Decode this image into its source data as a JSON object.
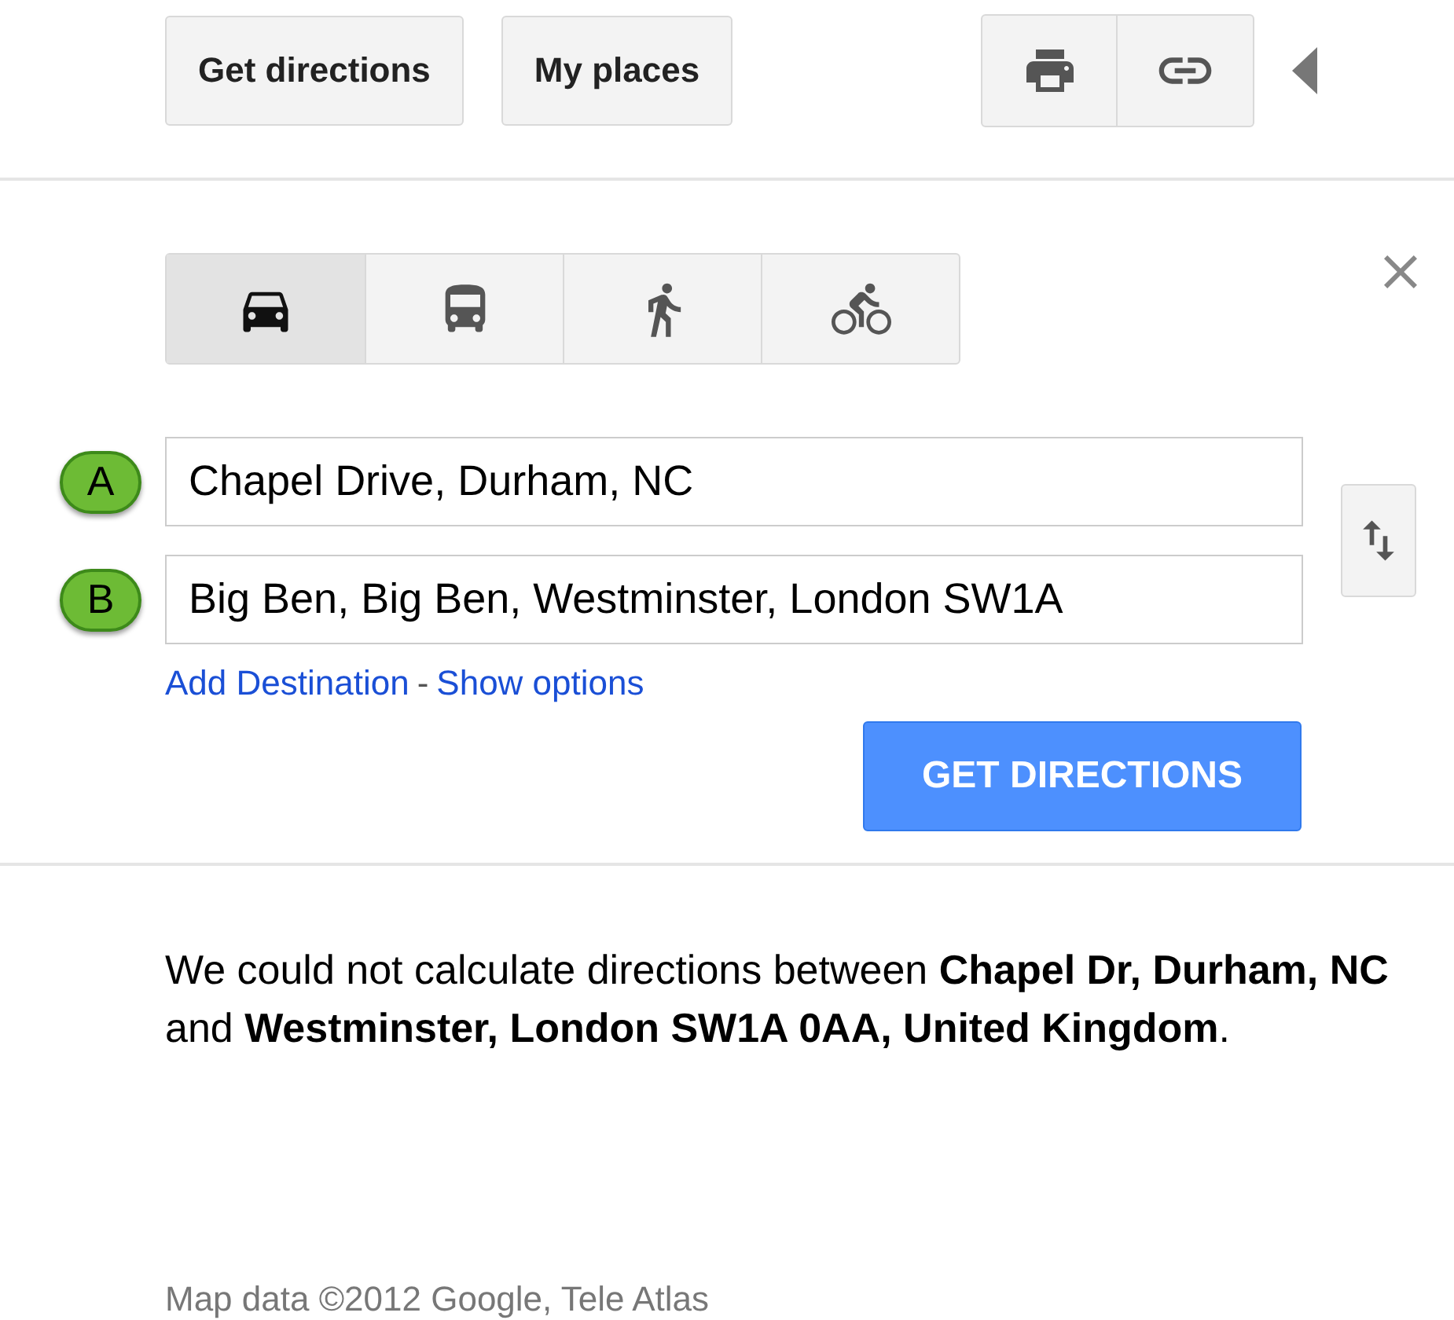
{
  "top_buttons": [
    "Get directions",
    "My places"
  ],
  "travel_modes": [
    {
      "kind": "car",
      "selected": true
    },
    {
      "kind": "transit",
      "selected": false
    },
    {
      "kind": "walk",
      "selected": false
    },
    {
      "kind": "bike",
      "selected": false
    }
  ],
  "waypoints": [
    {
      "marker": "A",
      "value": "Chapel Drive, Durham, NC"
    },
    {
      "marker": "B",
      "value": "Big Ben, Big Ben, Westminster, London SW1A"
    }
  ],
  "links": [
    "Add Destination",
    "-",
    "Show options"
  ],
  "get_directions_button": "GET DIRECTIONS",
  "message": "We could not calculate directions between **Chapel Dr, Durham, NC** and **Westminster, London SW1A 0AA, United Kingdom**.",
  "footer": "Map data ©2012 Google, Tele Atlas"
}
